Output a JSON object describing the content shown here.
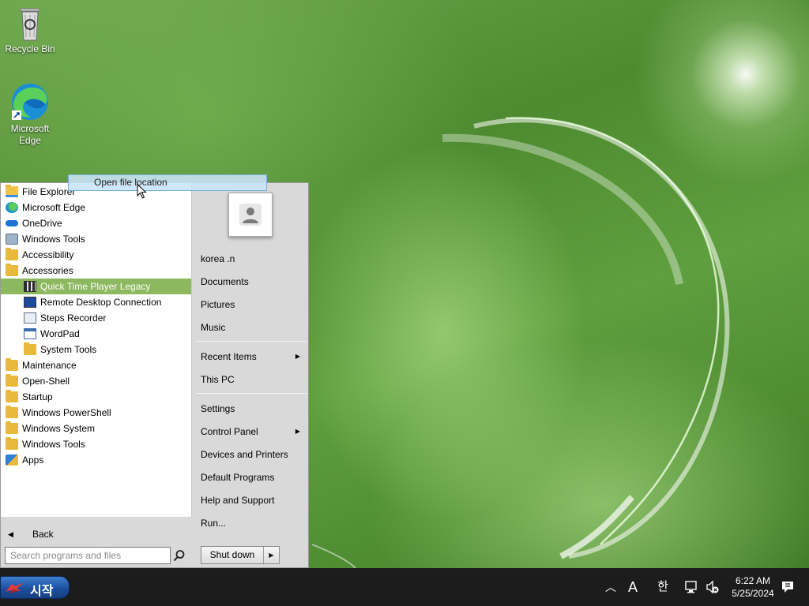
{
  "desktop": {
    "icons": [
      {
        "label": "Recycle Bin",
        "icon": "recycle-bin-icon"
      },
      {
        "label": "Microsoft\nEdge",
        "icon": "edge-icon"
      }
    ]
  },
  "start_menu": {
    "drag_tooltip": "Open file location",
    "programs": [
      {
        "label": "File Explorer",
        "icon": "file-explorer-icon"
      },
      {
        "label": "Microsoft Edge",
        "icon": "edge-icon"
      },
      {
        "label": "OneDrive",
        "icon": "onedrive-icon"
      },
      {
        "label": "Windows Tools",
        "icon": "windows-tools-icon"
      },
      {
        "label": "Accessibility",
        "icon": "folder-icon"
      },
      {
        "label": "Accessories",
        "icon": "folder-icon"
      },
      {
        "label": "Quick Time Player Legacy",
        "icon": "quicktime-icon",
        "selected": true
      },
      {
        "label": "Remote Desktop Connection",
        "icon": "remote-desktop-icon"
      },
      {
        "label": "Steps Recorder",
        "icon": "steps-recorder-icon"
      },
      {
        "label": "WordPad",
        "icon": "wordpad-icon"
      },
      {
        "label": "System Tools",
        "icon": "folder-icon"
      },
      {
        "label": "Maintenance",
        "icon": "folder-icon"
      },
      {
        "label": "Open-Shell",
        "icon": "folder-icon"
      },
      {
        "label": "Startup",
        "icon": "folder-icon"
      },
      {
        "label": "Windows PowerShell",
        "icon": "folder-icon"
      },
      {
        "label": "Windows System",
        "icon": "folder-icon"
      },
      {
        "label": "Windows Tools",
        "icon": "folder-icon"
      },
      {
        "label": "Apps",
        "icon": "apps-icon"
      }
    ],
    "back_label": "Back",
    "search_placeholder": "Search programs and files",
    "right": {
      "user": "korea .n",
      "documents": "Documents",
      "pictures": "Pictures",
      "music": "Music",
      "recent_items": "Recent Items",
      "this_pc": "This PC",
      "settings": "Settings",
      "control_panel": "Control Panel",
      "devices_printers": "Devices and Printers",
      "default_programs": "Default Programs",
      "help_support": "Help and Support",
      "run": "Run..."
    },
    "shutdown_label": "Shut down"
  },
  "taskbar": {
    "start_label": "시작",
    "ime_latin": "A",
    "ime_korean": "한",
    "time": "6:22 AM",
    "date": "5/25/2024"
  }
}
